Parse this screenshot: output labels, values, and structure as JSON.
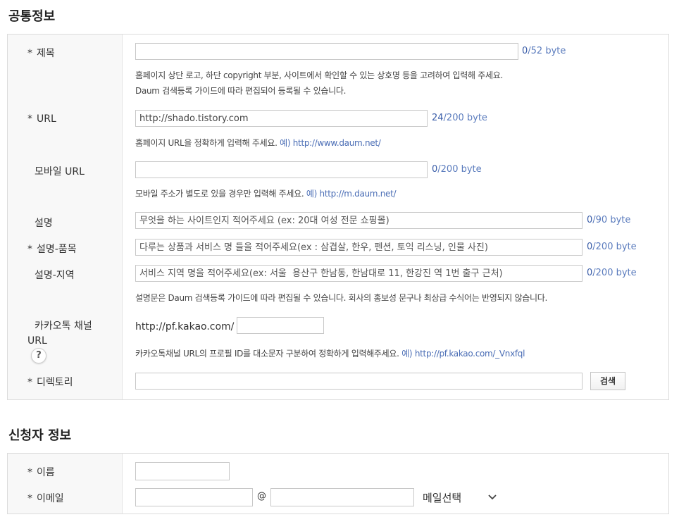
{
  "common_section": {
    "title": "공통정보",
    "title_field": {
      "required": "*",
      "label": "제목",
      "value": "",
      "byte_count": "0",
      "byte_limit": "/52 byte",
      "help_line1": "홈페이지 상단 로고, 하단 copyright 부분, 사이트에서 확인할 수 있는 상호명 등을 고려하여 입력해 주세요.",
      "help_line2": "Daum 검색등록 가이드에 따라 편집되어 등록될 수 있습니다."
    },
    "url_field": {
      "required": "*",
      "label": "URL",
      "value": "http://shado.tistory.com",
      "byte_count": "24",
      "byte_limit": "/200 byte",
      "help": "홈페이지 URL을 정확하게 입력해 주세요.",
      "example": "예) http://www.daum.net/"
    },
    "mobile_url_field": {
      "label": "모바일 URL",
      "value": "",
      "byte_count": "0",
      "byte_limit": "/200 byte",
      "help": "모바일 주소가 별도로 있을 경우만 입력해 주세요.",
      "example": "예) http://m.daum.net/"
    },
    "description_field": {
      "label": "설명",
      "placeholder": "무엇을 하는 사이트인지 적어주세요 (ex: 20대 여성 전문 쇼핑몰)",
      "byte_count": "0",
      "byte_limit": "/90 byte"
    },
    "description_items_field": {
      "required": "*",
      "label": "설명-품목",
      "placeholder": "다루는 상품과 서비스 명 들을 적어주세요(ex : 삼겹살, 한우, 펜션, 토익 리스닝, 인물 사진)",
      "byte_count": "0",
      "byte_limit": "/200 byte"
    },
    "description_region_field": {
      "label": "설명-지역",
      "placeholder": "서비스 지역 명을 적어주세요(ex: 서울  용산구 한남동, 한남대로 11, 한강진 역 1번 출구 근처)",
      "byte_count": "0",
      "byte_limit": "/200 byte",
      "help": "설명문은 Daum 검색등록 가이드에 따라 편집될 수 있습니다. 회사의 홍보성 문구나 최상급 수식어는 반영되지 않습니다."
    },
    "kakao_field": {
      "label_line1": "카카오톡 채널",
      "label_line2": "URL",
      "help_icon": "?",
      "prefix": "http://pf.kakao.com/",
      "value": "",
      "help": "카카오톡채널 URL의 프로필 ID를 대소문자 구분하여 정확하게 입력해주세요.",
      "example": "예) http://pf.kakao.com/_Vnxfql"
    },
    "directory_field": {
      "required": "*",
      "label": "디렉토리",
      "value": "",
      "search_button": "검색"
    }
  },
  "applicant_section": {
    "title": "신청자 정보",
    "name_field": {
      "required": "*",
      "label": "이름",
      "value": ""
    },
    "email_field": {
      "required": "*",
      "label": "이메일",
      "local_value": "",
      "at": "@",
      "domain_value": "",
      "select_label": "메일선택",
      "select_icon": "chevron-down-icon"
    }
  }
}
